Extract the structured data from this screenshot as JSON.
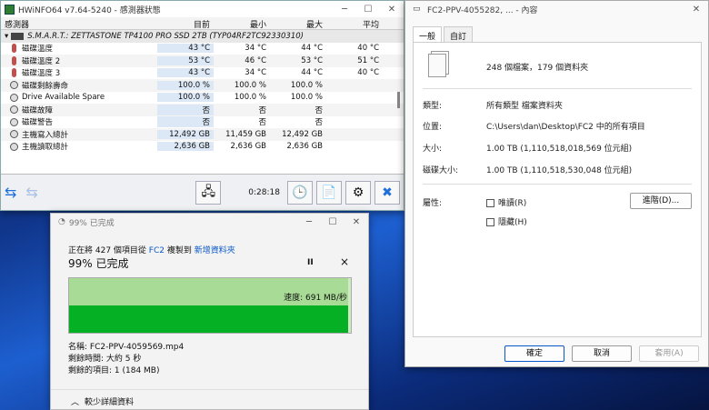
{
  "hwinfo": {
    "title": "HWiNFO64 v7.64-5240 - 感測器狀態",
    "headers": [
      "感測器",
      "目前",
      "最小",
      "最大",
      "平均"
    ],
    "device": "S.M.A.R.T.: ZETTASTONE TP4100 PRO SSD 2TB (TYP04RF2TC92330310)",
    "rows": [
      {
        "icon": "thermometer-icon",
        "name": "磁碟溫度",
        "cur": "43 °C",
        "min": "34 °C",
        "max": "44 °C",
        "avg": "40 °C"
      },
      {
        "icon": "thermometer-icon",
        "name": "磁碟溫度 2",
        "cur": "53 °C",
        "min": "46 °C",
        "max": "53 °C",
        "avg": "51 °C"
      },
      {
        "icon": "thermometer-icon",
        "name": "磁碟溫度 3",
        "cur": "43 °C",
        "min": "34 °C",
        "max": "44 °C",
        "avg": "40 °C"
      },
      {
        "icon": "gauge-icon",
        "name": "磁碟剩餘壽命",
        "cur": "100.0 %",
        "min": "100.0 %",
        "max": "100.0 %",
        "avg": ""
      },
      {
        "icon": "gauge-icon",
        "name": "Drive Available Spare",
        "cur": "100.0 %",
        "min": "100.0 %",
        "max": "100.0 %",
        "avg": ""
      },
      {
        "icon": "gauge-icon",
        "name": "磁碟故障",
        "cur": "否",
        "min": "否",
        "max": "否",
        "avg": ""
      },
      {
        "icon": "gauge-icon",
        "name": "磁碟警告",
        "cur": "否",
        "min": "否",
        "max": "否",
        "avg": ""
      },
      {
        "icon": "gauge-icon",
        "name": "主機寫入總計",
        "cur": "12,492 GB",
        "min": "11,459 GB",
        "max": "12,492 GB",
        "avg": ""
      },
      {
        "icon": "gauge-icon",
        "name": "主機讀取總計",
        "cur": "2,636 GB",
        "min": "2,636 GB",
        "max": "2,636 GB",
        "avg": ""
      }
    ],
    "timer": "0:28:18"
  },
  "copy": {
    "title": "99% 已完成",
    "desc_prefix": "正在將 427 個項目從",
    "src": "FC2",
    "desc_mid": "複製到",
    "dest": "新增資料夾",
    "percent": "99% 已完成",
    "pause": "II",
    "close": "×",
    "speed": "速度: 691 MB/秒",
    "progress": 0.99,
    "name": "名稱: FC2-PPV-4059569.mp4",
    "time": "剩餘時間: 大約 5 秒",
    "items": "剩餘的項目: 1 (184 MB)",
    "less": "較少詳細資料"
  },
  "props": {
    "title": "FC2-PPV-4055282, ... - 內容",
    "tabs": [
      "一般",
      "自訂"
    ],
    "summary": "248 個檔案，179 個資料夾",
    "type_l": "類型:",
    "type_v": "所有類型 檔案資料夾",
    "loc_l": "位置:",
    "loc_v": "C:\\Users\\dan\\Desktop\\FC2 中的所有項目",
    "size_l": "大小:",
    "size_v": "1.00 TB (1,110,518,018,569 位元組)",
    "disk_l": "磁碟大小:",
    "disk_v": "1.00 TB (1,110,518,530,048 位元組)",
    "attr_l": "屬性:",
    "ro": "唯讀(R)",
    "hidden": "隱藏(H)",
    "adv": "進階(D)...",
    "ok": "確定",
    "cancel": "取消",
    "apply": "套用(A)"
  }
}
